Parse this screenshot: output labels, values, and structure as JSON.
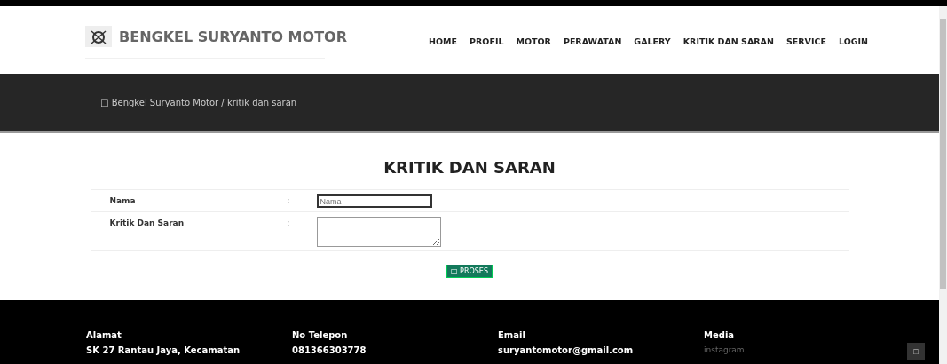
{
  "header": {
    "brand": "BENGKEL SURYANTO MOTOR",
    "nav": [
      {
        "label": "HOME"
      },
      {
        "label": "PROFIL"
      },
      {
        "label": "MOTOR"
      },
      {
        "label": "PERAWATAN"
      },
      {
        "label": "GALERY"
      },
      {
        "label": "KRITIK DAN SARAN"
      },
      {
        "label": "SERVICE"
      },
      {
        "label": "LOGIN"
      }
    ]
  },
  "breadcrumb": {
    "icon": "□",
    "text": "Bengkel Suryanto Motor / kritik dan saran"
  },
  "form": {
    "title": "KRITIK DAN SARAN",
    "fields": [
      {
        "label": "Nama",
        "separator": ":",
        "kind": "input",
        "placeholder": "Nama"
      },
      {
        "label": "Kritik Dan Saran",
        "separator": ":",
        "kind": "textarea"
      }
    ],
    "submit": {
      "icon": "□",
      "label": "PROSES"
    }
  },
  "footer": {
    "columns": [
      {
        "heading": "Alamat",
        "text": "SK 27 Rantau Jaya, Kecamatan"
      },
      {
        "heading": "No Telepon",
        "text": "081366303778"
      },
      {
        "heading": "Email",
        "text": "suryantomotor@gmail.com"
      },
      {
        "heading": "Media",
        "text": "instagram"
      }
    ],
    "top_button": "□"
  }
}
